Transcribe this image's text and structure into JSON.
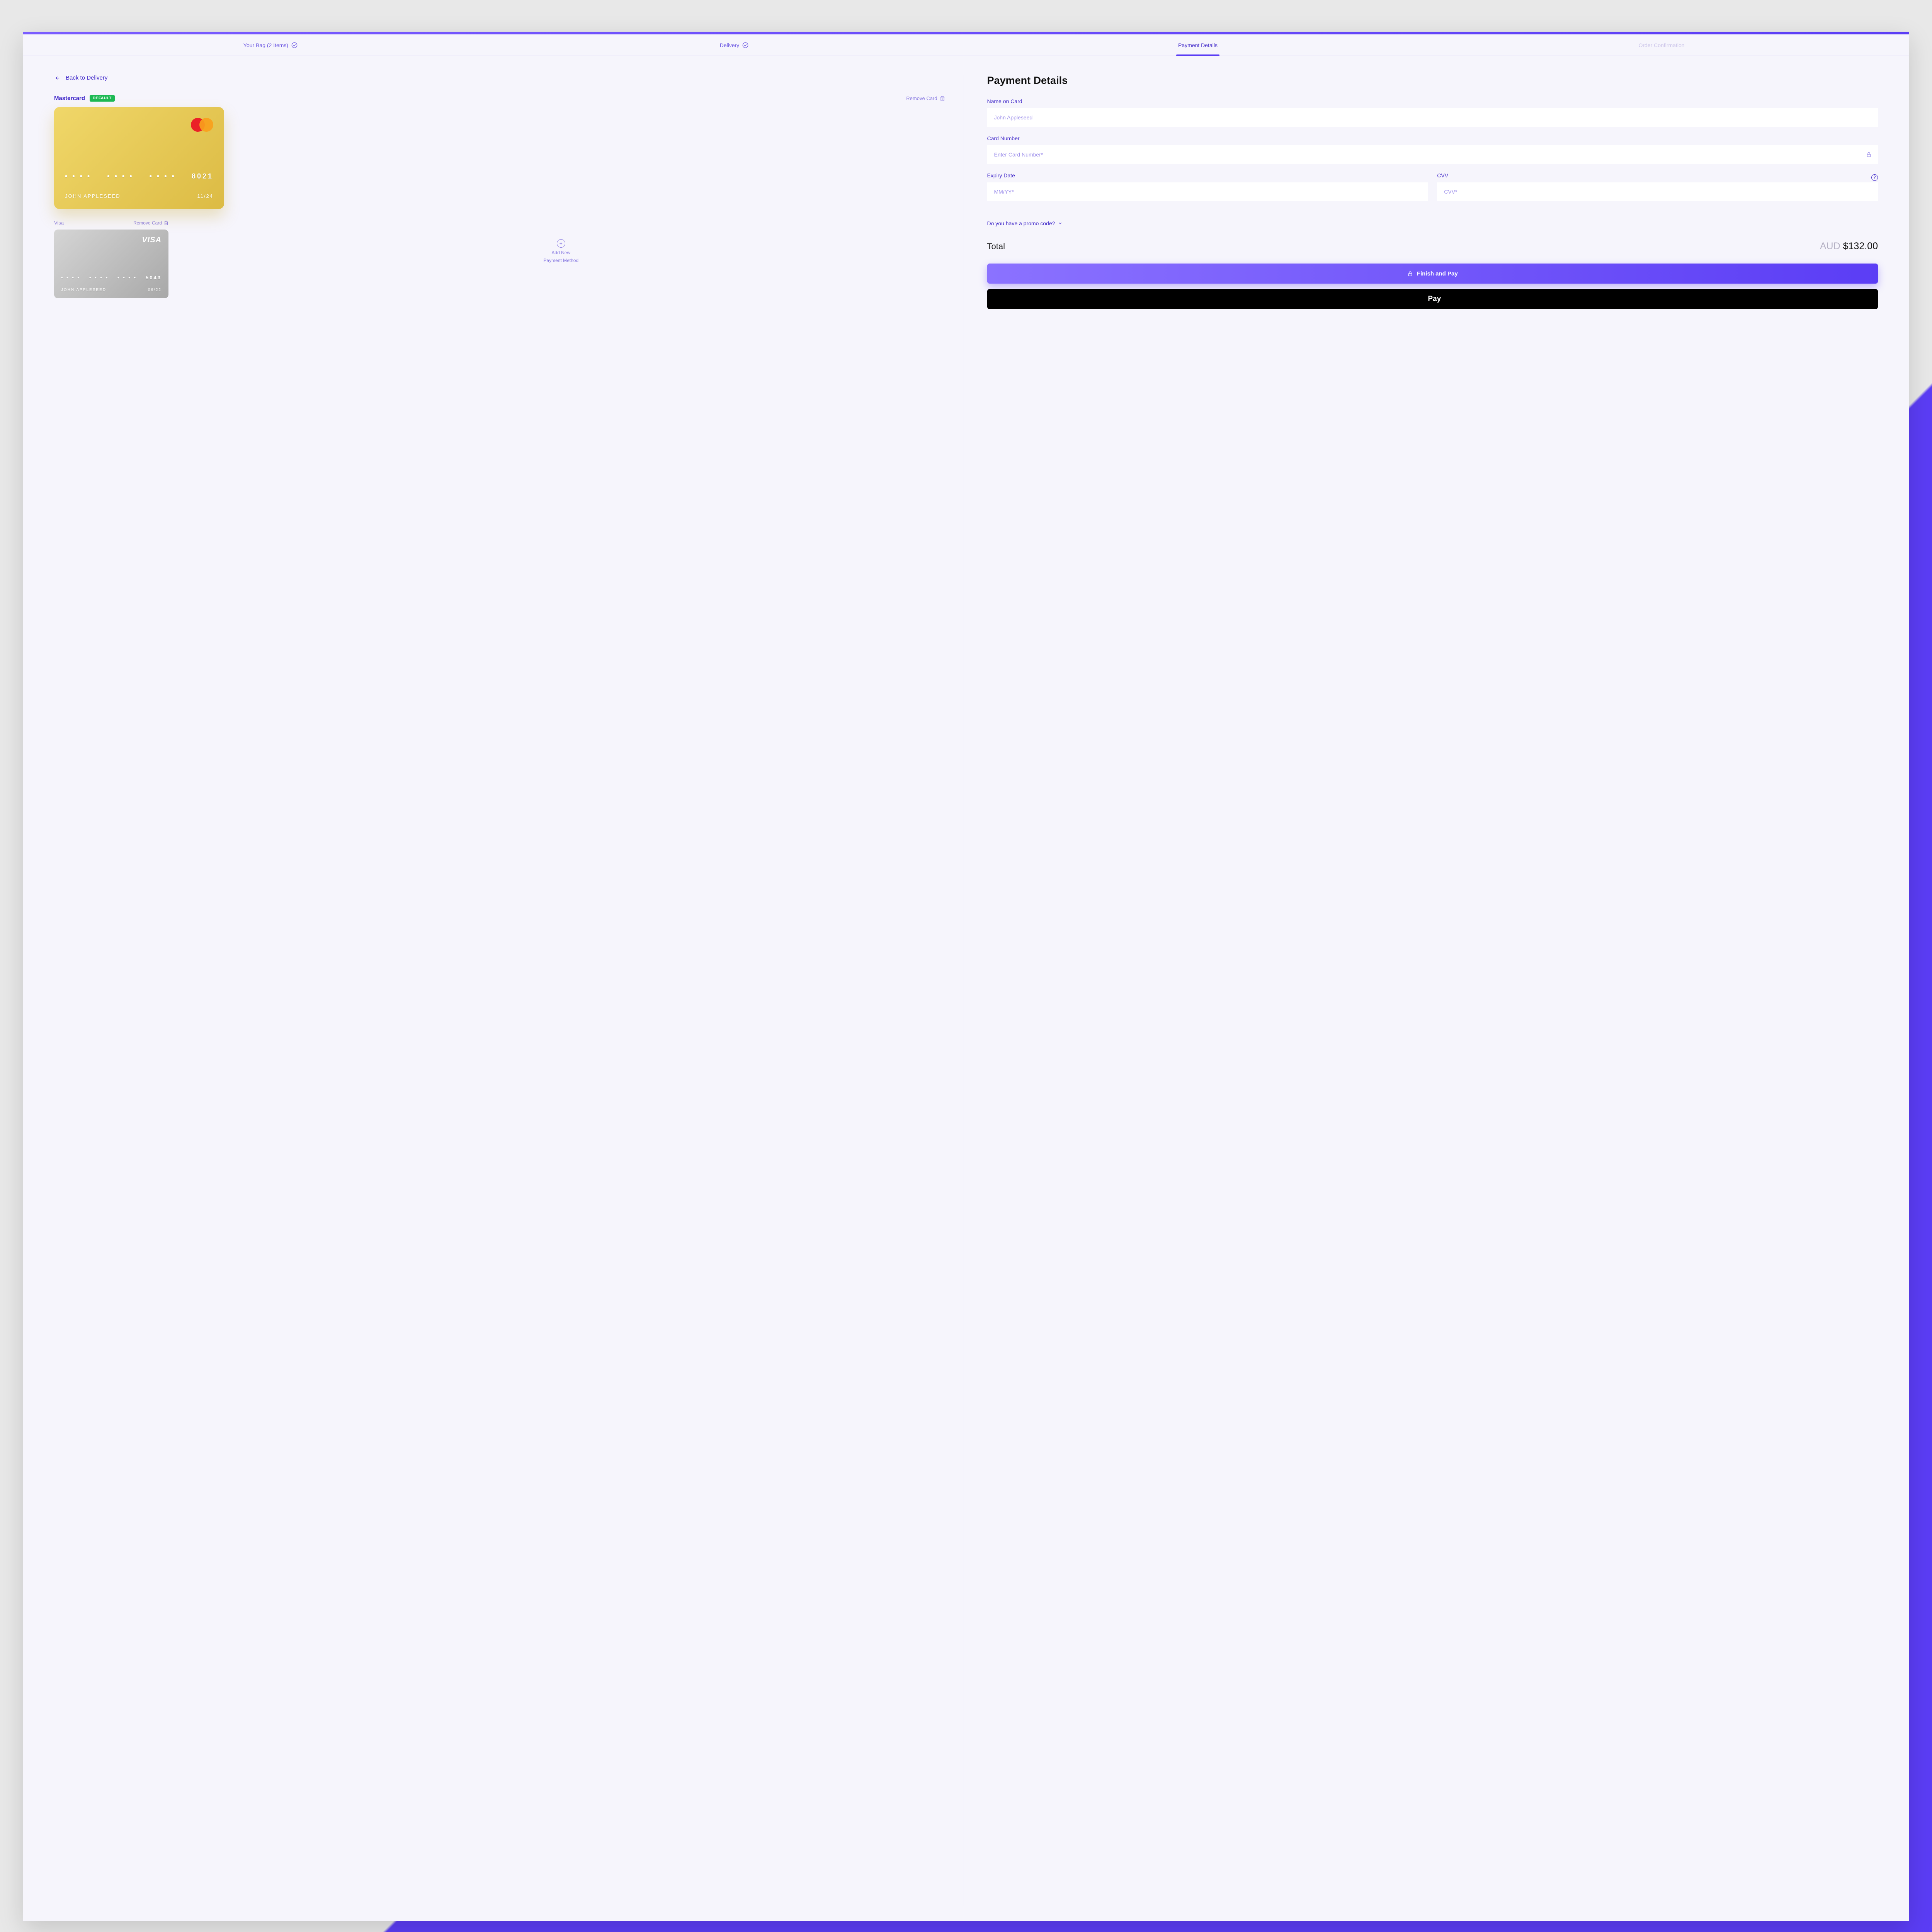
{
  "tabs": {
    "bag": "Your Bag (2 Items)",
    "delivery": "Delivery",
    "payment": "Payment Details",
    "confirm": "Order Confirmation"
  },
  "back_label": "Back to Delivery",
  "cards": {
    "primary": {
      "name": "Mastercard",
      "default_badge": "DEFAULT",
      "remove": "Remove Card",
      "last4": "8021",
      "holder": "JOHN APPLESEED",
      "expiry": "11/24"
    },
    "secondary": {
      "name": "Visa",
      "remove": "Remove Card",
      "brand": "VISA",
      "last4": "5043",
      "holder": "JOHN APPLESEED",
      "expiry": "06/22"
    }
  },
  "add_method": {
    "line1": "Add New",
    "line2": "Payment Method"
  },
  "form": {
    "title": "Payment Details",
    "name_label": "Name on Card",
    "name_value": "John Appleseed",
    "number_label": "Card Number",
    "number_placeholder": "Enter Card Number*",
    "expiry_label": "Expiry Date",
    "expiry_placeholder": "MM/YY*",
    "cvv_label": "CVV",
    "cvv_placeholder": "CVV*"
  },
  "promo_label": "Do you have a promo code?",
  "total": {
    "label": "Total",
    "currency": "AUD",
    "amount": "$132.00"
  },
  "buttons": {
    "finish": "Finish and Pay",
    "apple": "Pay"
  },
  "dots": "• • • •"
}
